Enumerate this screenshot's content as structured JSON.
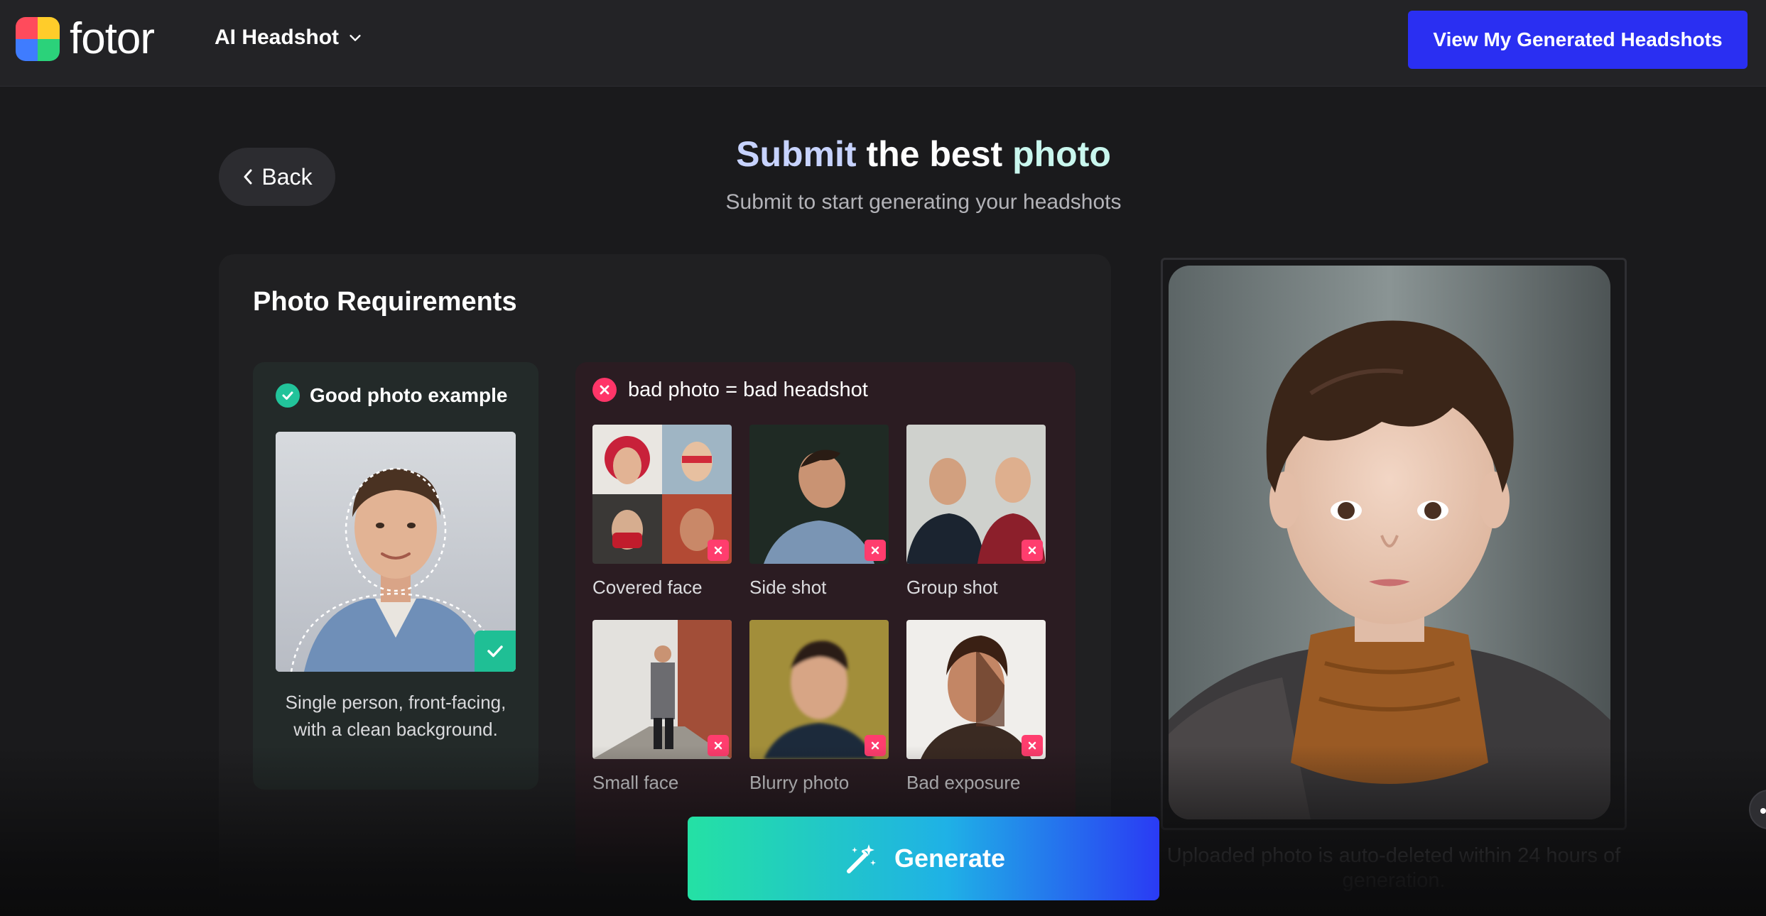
{
  "header": {
    "logo_text": "fotor",
    "product_menu": "AI Headshot",
    "view_button": "View My Generated Headshots"
  },
  "hero": {
    "back_label": "Back",
    "title_part1": "Submit",
    "title_part2": "the best",
    "title_part3": "photo",
    "subtitle": "Submit to start generating your headshots"
  },
  "requirements": {
    "title": "Photo Requirements",
    "good": {
      "heading": "Good photo example",
      "description": "Single person, front-facing, with a clean background."
    },
    "bad": {
      "heading": "bad photo = bad headshot",
      "items": [
        {
          "label": "Covered face"
        },
        {
          "label": "Side shot"
        },
        {
          "label": "Group shot"
        },
        {
          "label": "Small face"
        },
        {
          "label": "Blurry photo"
        },
        {
          "label": "Bad exposure"
        }
      ]
    }
  },
  "upload": {
    "note": "Uploaded photo is auto-deleted within 24 hours of generation."
  },
  "actions": {
    "generate_label": "Generate"
  },
  "colors": {
    "accent_blue": "#2a2ff2",
    "good_green": "#22c39a",
    "bad_red": "#ff3568"
  }
}
